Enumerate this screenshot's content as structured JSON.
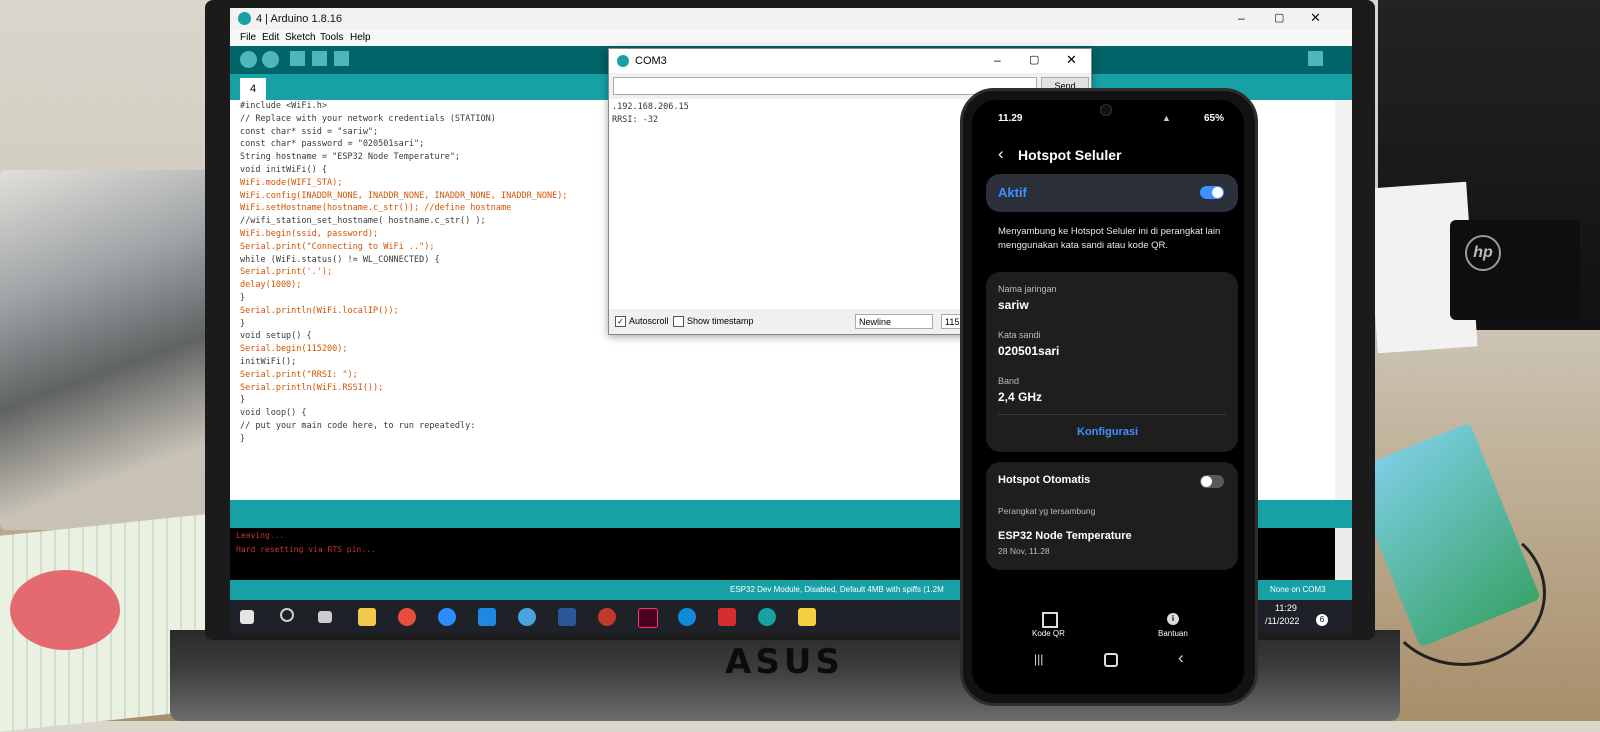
{
  "arduino": {
    "window_title": "4 | Arduino 1.8.16",
    "menu": [
      "File",
      "Edit",
      "Sketch",
      "Tools",
      "Help"
    ],
    "tab_label": "4",
    "code_lines": [
      "#include <WiFi.h>",
      "// Replace with your network credentials (STATION)",
      "const char* ssid = \"sariw\";",
      "const char* password = \"020501sari\";",
      "String hostname = \"ESP32 Node Temperature\";",
      "void initWiFi() {",
      "WiFi.mode(WIFI_STA);",
      "WiFi.config(INADDR_NONE, INADDR_NONE, INADDR_NONE, INADDR_NONE);",
      "WiFi.setHostname(hostname.c_str()); //define hostname",
      "//wifi_station_set_hostname( hostname.c_str() );",
      "WiFi.begin(ssid, password);",
      "Serial.print(\"Connecting to WiFi ..\");",
      "while (WiFi.status() != WL_CONNECTED) {",
      "Serial.print('.');",
      "delay(1000);",
      "}",
      "Serial.println(WiFi.localIP());",
      "}",
      "void setup() {",
      "Serial.begin(115200);",
      "initWiFi();",
      "Serial.print(\"RRSI: \");",
      "Serial.println(WiFi.RSSI());",
      "}",
      "void loop() {",
      "// put your main code here, to run repeatedly:",
      "}"
    ],
    "console_lines": [
      "Leaving...",
      "Hard resetting via RTS pin..."
    ],
    "status_bar": "ESP32 Dev Module, Disabled, Default 4MB with spiffs (1.2M",
    "status_bar_right": "None on COM3",
    "clock_time": "11:29",
    "clock_date": "/11/2022",
    "notification_count": "6"
  },
  "serial_monitor": {
    "title": "COM3",
    "send_label": "Send",
    "output_lines": [
      ".192.168.206.15",
      "RRSI: -32"
    ],
    "autoscroll_label": "Autoscroll",
    "autoscroll_checked": true,
    "timestamp_label": "Show timestamp",
    "timestamp_checked": false,
    "line_ending": "Newline",
    "baud": "115"
  },
  "phone": {
    "status_time": "11.29",
    "battery": "65%",
    "screen_title": "Hotspot Seluler",
    "active_label": "Aktif",
    "active_on": true,
    "description": "Menyambung ke Hotspot Seluler ini di perangkat lain menggunakan kata sandi atau kode QR.",
    "network_name_label": "Nama jaringan",
    "network_name": "sariw",
    "password_label": "Kata sandi",
    "password": "020501sari",
    "band_label": "Band",
    "band": "2,4 GHz",
    "configure_label": "Konfigurasi",
    "auto_hotspot_label": "Hotspot Otomatis",
    "auto_hotspot_on": false,
    "connected_devices_label": "Perangkat yg tersambung",
    "device_name": "ESP32 Node Temperature",
    "device_time": "28 Nov, 11.28",
    "qr_label": "Kode QR",
    "help_label": "Bantuan",
    "accent_color": "#3e91ff"
  },
  "laptop_brand": "ASUS"
}
